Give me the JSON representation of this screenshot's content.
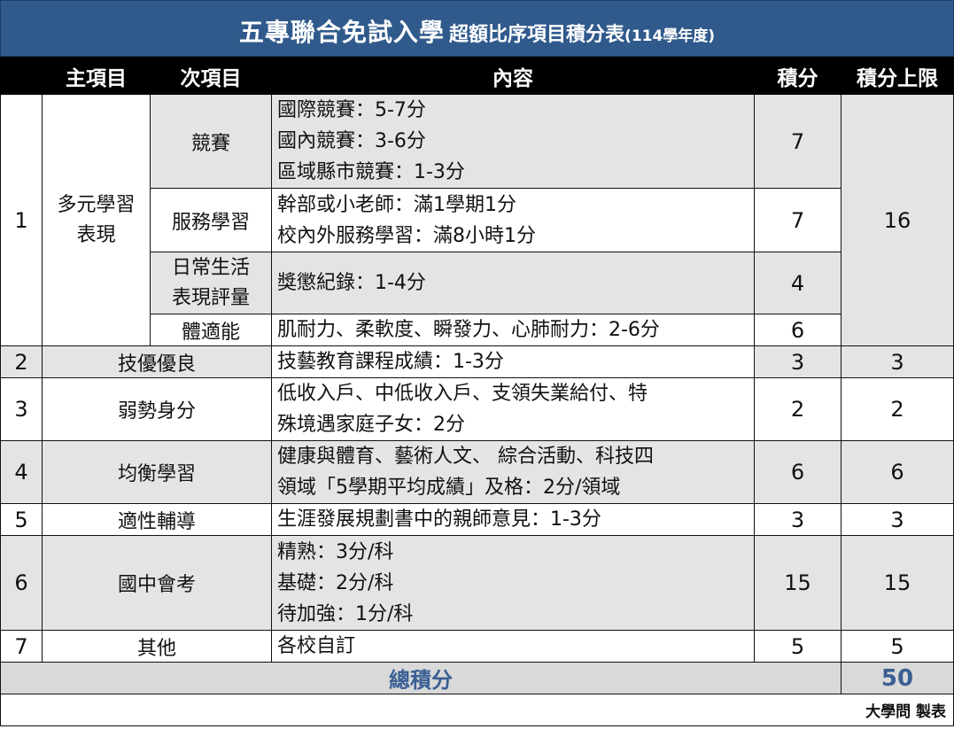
{
  "title": {
    "main": "五專聯合免試入學",
    "sub": "超額比序項目積分表",
    "year": "(114學年度)"
  },
  "headers": [
    "",
    "主項目",
    "次項目",
    "內容",
    "積分",
    "積分上限"
  ],
  "rows": {
    "r1": {
      "no": "1",
      "main": [
        "多元學習",
        "表現"
      ],
      "limit": "16",
      "subs": [
        {
          "name": [
            "競賽"
          ],
          "content": [
            "國際競賽：5-7分",
            "國內競賽：3-6分",
            "區域縣市競賽：1-3分"
          ],
          "score": "7"
        },
        {
          "name": [
            "服務學習"
          ],
          "content": [
            "幹部或小老師：滿1學期1分",
            "校內外服務學習：滿8小時1分"
          ],
          "score": "7"
        },
        {
          "name": [
            "日常生活",
            "表現評量"
          ],
          "content": [
            "獎懲紀錄：1-4分"
          ],
          "score": "4"
        },
        {
          "name": [
            "體適能"
          ],
          "content": [
            "肌耐力、柔軟度、瞬發力、心肺耐力：2-6分"
          ],
          "score": "6"
        }
      ]
    },
    "r2": {
      "no": "2",
      "main": "技優優良",
      "content": [
        "技藝教育課程成績：1-3分"
      ],
      "score": "3",
      "limit": "3"
    },
    "r3": {
      "no": "3",
      "main": "弱勢身分",
      "content": [
        "低收入戶、中低收入戶、支領失業給付、特",
        "殊境遇家庭子女：2分"
      ],
      "score": "2",
      "limit": "2"
    },
    "r4": {
      "no": "4",
      "main": "均衡學習",
      "content": [
        "健康與體育、藝術人文、 綜合活動、科技四",
        "領域「5學期平均成績」及格：2分/領域"
      ],
      "score": "6",
      "limit": "6"
    },
    "r5": {
      "no": "5",
      "main": "適性輔導",
      "content": [
        "生涯發展規劃書中的親師意見：1-3分"
      ],
      "score": "3",
      "limit": "3"
    },
    "r6": {
      "no": "6",
      "main": "國中會考",
      "content": [
        "精熟：3分/科",
        "基礎：2分/科",
        "待加強：1分/科"
      ],
      "score": "15",
      "limit": "15"
    },
    "r7": {
      "no": "7",
      "main": "其他",
      "content": [
        "各校自訂"
      ],
      "score": "5",
      "limit": "5"
    }
  },
  "total": {
    "label": "總積分",
    "value": "50"
  },
  "credit": "大學問 製表",
  "colors": {
    "title_bg": "#305a8c",
    "header_bg": "#000000",
    "grey_row": "#e4e4e4",
    "total_text": "#3a5f94"
  }
}
